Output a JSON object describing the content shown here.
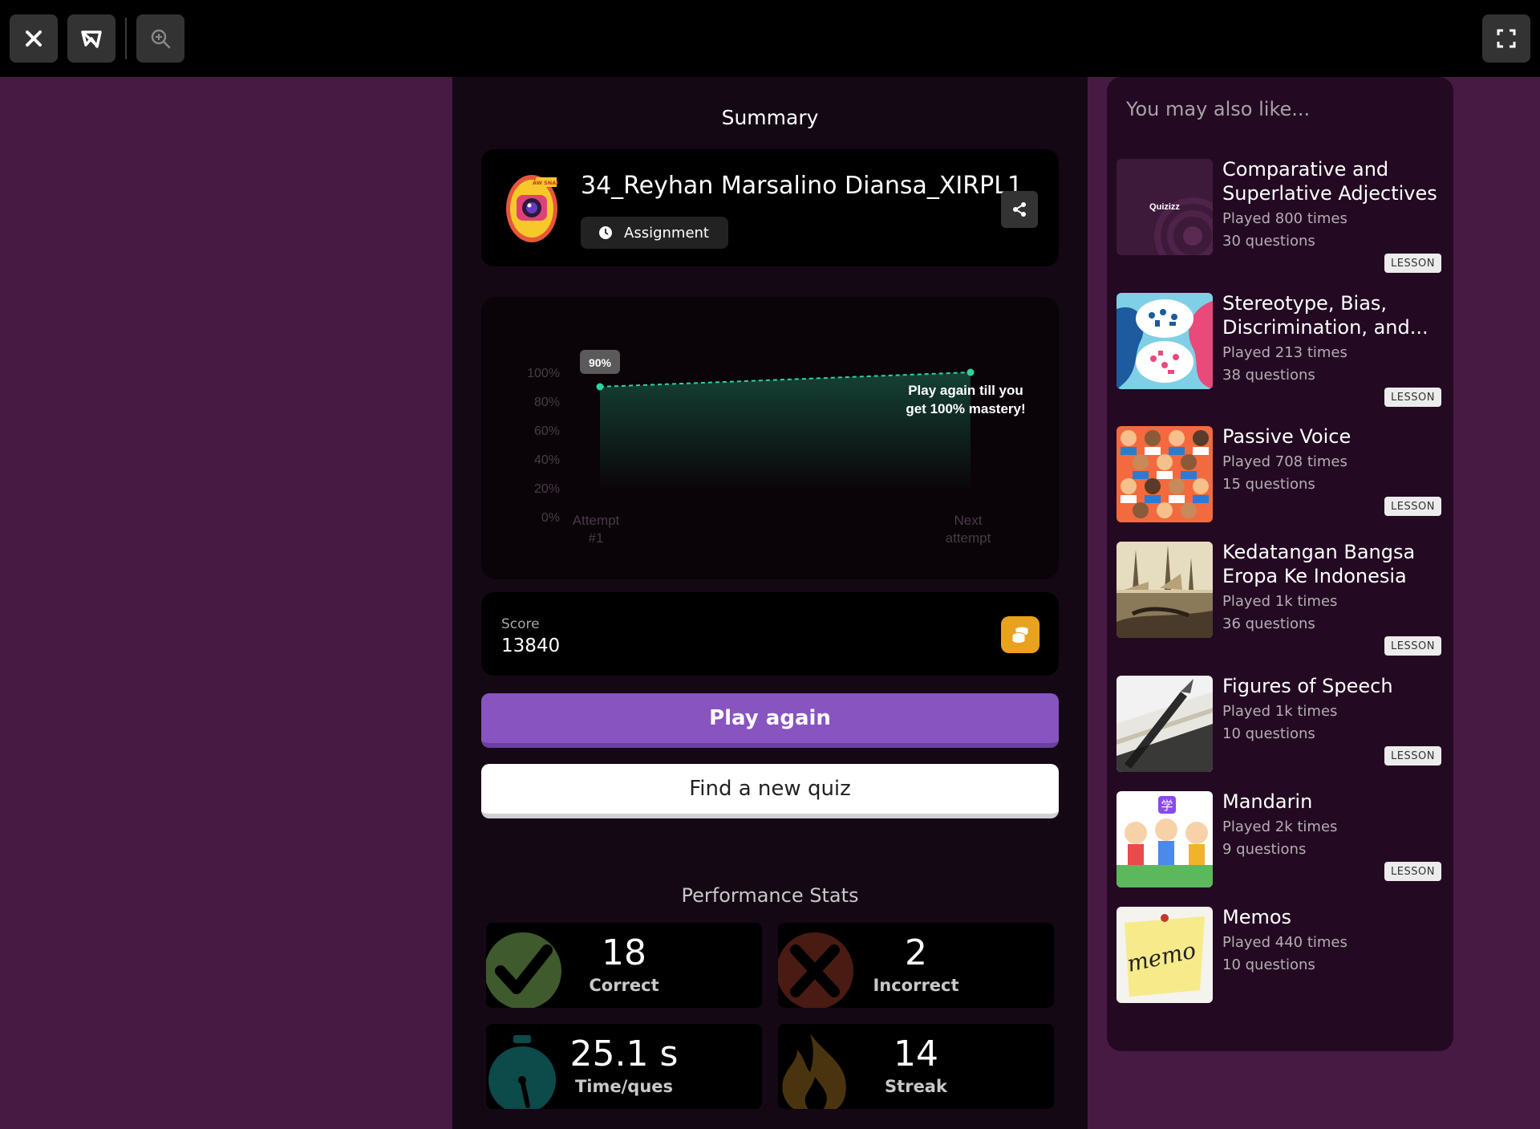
{
  "topbar": {
    "icons": [
      "close-icon",
      "quizizz-logo-icon",
      "zoom-in-icon",
      "fullscreen-icon"
    ]
  },
  "summary": {
    "title": "Summary",
    "quiz_name": "34_Reyhan Marsalino Diansa_XIRPL1",
    "mode_label": "Assignment",
    "logo_caption": "AW SNAP"
  },
  "chart_data": {
    "type": "area",
    "x": [
      "Attempt #1",
      "Next attempt"
    ],
    "x_tick_lines": [
      [
        "Attempt",
        "#1"
      ],
      [
        "Next",
        "attempt"
      ]
    ],
    "y_ticks": [
      "100%",
      "80%",
      "60%",
      "40%",
      "20%",
      "0%"
    ],
    "ylim": [
      0,
      100
    ],
    "series": [
      {
        "values": [
          90,
          100
        ]
      }
    ],
    "point_label": "90%",
    "annotation_lines": [
      "Play again till you",
      "get 100% mastery!"
    ],
    "color": "#2fd39a"
  },
  "score": {
    "label": "Score",
    "value": "13840"
  },
  "buttons": {
    "play_again": "Play again",
    "find_quiz": "Find a new quiz"
  },
  "performance": {
    "title": "Performance Stats",
    "stats": [
      {
        "value": "18",
        "label": "Correct",
        "icon": "checkmark-icon",
        "color": "#3f5a2d"
      },
      {
        "value": "2",
        "label": "Incorrect",
        "icon": "x-mark-icon",
        "color": "#4a1b12"
      },
      {
        "value": "25.1 s",
        "label": "Time/ques",
        "icon": "stopwatch-icon",
        "color": "#0d4a4a"
      },
      {
        "value": "14",
        "label": "Streak",
        "icon": "flame-icon",
        "color": "#4a3410"
      }
    ]
  },
  "recommendations": {
    "title": "You may also like...",
    "items": [
      {
        "title": "Comparative and Superlative Adjectives",
        "played": "Played 800 times",
        "questions": "30 questions",
        "badge": "LESSON",
        "thumb_text": "Quizizz"
      },
      {
        "title": "Stereotype, Bias, Discrimination, and...",
        "played": "Played 213 times",
        "questions": "38 questions",
        "badge": "LESSON"
      },
      {
        "title": "Passive Voice",
        "played": "Played 708 times",
        "questions": "15 questions",
        "badge": "LESSON"
      },
      {
        "title": "Kedatangan Bangsa Eropa Ke Indonesia",
        "played": "Played 1k times",
        "questions": "36 questions",
        "badge": "LESSON"
      },
      {
        "title": "Figures of Speech",
        "played": "Played 1k times",
        "questions": "10 questions",
        "badge": "LESSON"
      },
      {
        "title": "Mandarin",
        "played": "Played 2k times",
        "questions": "9 questions",
        "badge": "LESSON",
        "thumb_text": "学"
      },
      {
        "title": "Memos",
        "played": "Played 440 times",
        "questions": "10 questions",
        "thumb_text": "memo"
      }
    ]
  }
}
